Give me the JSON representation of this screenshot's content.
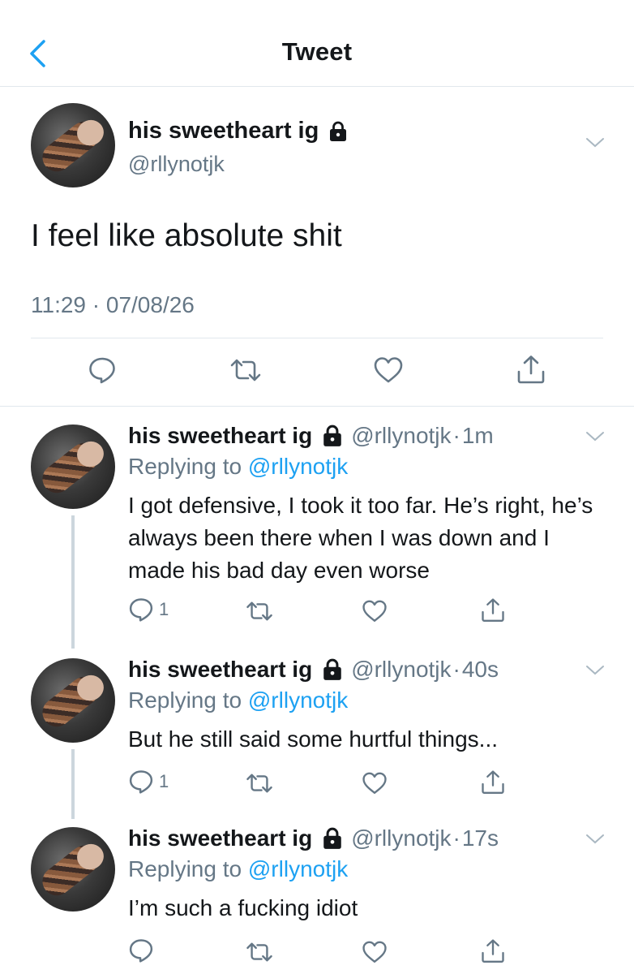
{
  "header": {
    "title": "Tweet"
  },
  "main_tweet": {
    "name": "his sweetheart ig",
    "handle": "@rllynotjk",
    "text": "I feel like absolute shit",
    "timestamp": "11:29 · 07/08/26"
  },
  "replies": [
    {
      "name": "his sweetheart ig",
      "handle": "@rllynotjk",
      "sep": "·",
      "time": "1m",
      "replying_prefix": "Replying to ",
      "replying_to": "@rllynotjk",
      "text": "I got defensive, I took it too far. He’s right, he’s always been there when I was down and I made his bad day even worse",
      "reply_count": "1"
    },
    {
      "name": "his sweetheart ig",
      "handle": "@rllynotjk",
      "sep": "·",
      "time": "40s",
      "replying_prefix": "Replying to ",
      "replying_to": "@rllynotjk",
      "text": "But he still said some hurtful things...",
      "reply_count": "1"
    },
    {
      "name": "his sweetheart ig",
      "handle": "@rllynotjk",
      "sep": "·",
      "time": "17s",
      "replying_prefix": "Replying to ",
      "replying_to": "@rllynotjk",
      "text": "I’m such a fucking idiot",
      "reply_count": ""
    }
  ],
  "icons": {
    "back": "chevron-left-icon",
    "lock": "lock-icon",
    "more": "chevron-down-icon",
    "reply": "reply-icon",
    "retweet": "retweet-icon",
    "like": "heart-icon",
    "share": "share-icon"
  },
  "colors": {
    "accent": "#1da1f2",
    "text": "#14171a",
    "secondary": "#657786",
    "divider": "#e1e8ed"
  }
}
